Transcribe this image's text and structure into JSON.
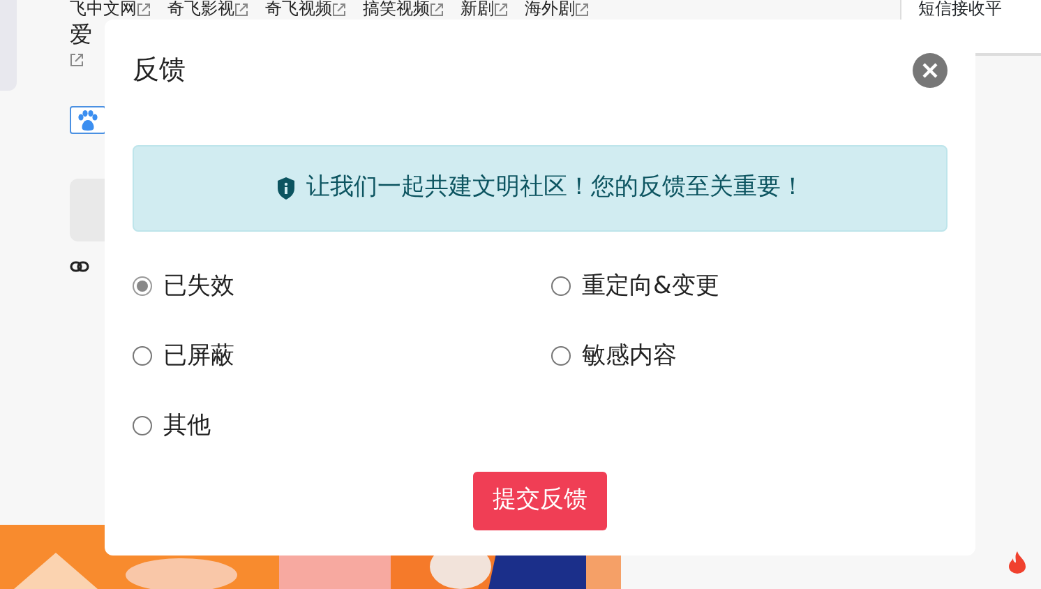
{
  "page": {
    "links": [
      {
        "label": "飞中文网"
      },
      {
        "label": "奇飞影视"
      },
      {
        "label": "奇飞视频"
      },
      {
        "label": "搞笑视频"
      },
      {
        "label": "新剧"
      },
      {
        "label": "海外剧"
      }
    ],
    "second_line": "爱",
    "side_item": "短信接收平"
  },
  "dialog": {
    "title": "反馈",
    "notice": "让我们一起共建文明社区！您的反馈至关重要！",
    "options": [
      {
        "label": "已失效",
        "selected": true
      },
      {
        "label": "重定向&变更",
        "selected": false
      },
      {
        "label": "已屏蔽",
        "selected": false
      },
      {
        "label": "敏感内容",
        "selected": false
      },
      {
        "label": "其他",
        "selected": false
      }
    ],
    "submit": "提交反馈"
  }
}
